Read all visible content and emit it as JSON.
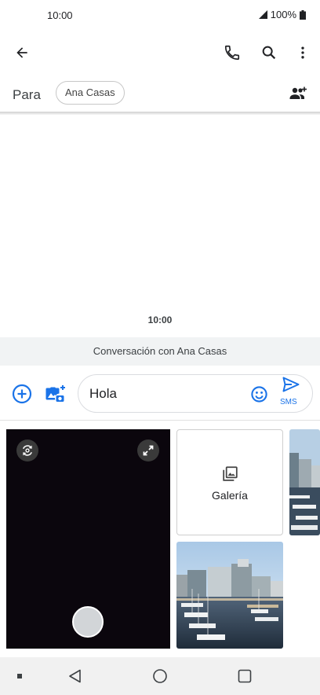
{
  "status_bar": {
    "time": "10:00",
    "battery": "100%",
    "icons": [
      "signal-icon",
      "battery-icon"
    ]
  },
  "app_bar": {
    "icons": [
      "back-arrow-icon",
      "phone-icon",
      "search-icon",
      "more-vert-icon"
    ]
  },
  "recipient": {
    "label": "Para",
    "chip": "Ana Casas",
    "add_icon": "add-people-icon"
  },
  "conversation": {
    "timestamp": "10:00",
    "banner": "Conversación con Ana Casas"
  },
  "compose": {
    "text": "Hola",
    "send_label": "SMS",
    "icons": [
      "add-circle-icon",
      "add-photo-icon",
      "emoji-icon",
      "send-icon"
    ]
  },
  "media_picker": {
    "gallery_label": "Galería",
    "camera_icons": [
      "switch-camera-icon",
      "fullscreen-icon",
      "shutter-button"
    ]
  },
  "colors": {
    "accent": "#1a73e8",
    "camera_bg": "#0b060d",
    "banner_bg": "#f1f3f4"
  },
  "nav_bar": {
    "icons": [
      "dot-icon",
      "back-icon",
      "home-icon",
      "recents-icon"
    ]
  }
}
